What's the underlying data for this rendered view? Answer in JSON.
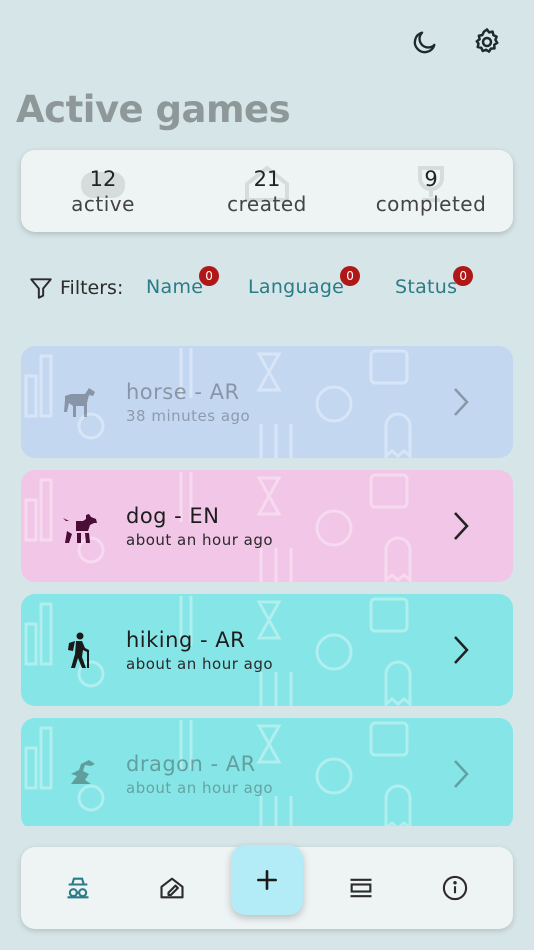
{
  "header": {
    "title": "Active games",
    "theme_icon": "moon-icon",
    "settings_icon": "gear-icon"
  },
  "stats": [
    {
      "value": "12",
      "label": "active"
    },
    {
      "value": "21",
      "label": "created"
    },
    {
      "value": "9",
      "label": "completed"
    }
  ],
  "filters": {
    "label": "Filters:",
    "chips": [
      {
        "label": "Name",
        "count": "0"
      },
      {
        "label": "Language",
        "count": "0"
      },
      {
        "label": "Status",
        "count": "0"
      }
    ]
  },
  "games": [
    {
      "name": "horse - AR",
      "time": "38 minutes ago",
      "icon": "horse-icon",
      "color": "#c3d7f1"
    },
    {
      "name": "dog - EN",
      "time": "about an hour ago",
      "icon": "dog-icon",
      "color": "#f2c6e6"
    },
    {
      "name": "hiking - AR",
      "time": "about an hour ago",
      "icon": "hiker-icon",
      "color": "#86e5e6"
    },
    {
      "name": "dragon - AR",
      "time": "about an hour ago",
      "icon": "dragon-icon",
      "color": "#86e5e6"
    }
  ],
  "bottom_nav": {
    "items": [
      "spy-icon",
      "edit-house-icon",
      "add-icon",
      "list-icon",
      "info-icon"
    ]
  },
  "colors": {
    "background": "#d6e5e8",
    "accent": "#2a7c86",
    "badge": "#b01818",
    "fab": "#b3ecf7"
  }
}
